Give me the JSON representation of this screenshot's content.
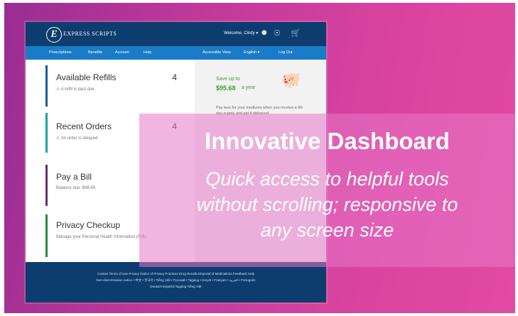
{
  "header": {
    "brand": "EXPRESS SCRIPTS",
    "welcome": "Welcome, Cindy ▾",
    "icons": [
      "user-icon",
      "globe-icon",
      "cart-icon"
    ]
  },
  "nav": {
    "left": [
      "Prescriptions",
      "Benefits",
      "Account",
      "Help"
    ],
    "right": [
      "Accessible View",
      "English ▾",
      "Log Out"
    ]
  },
  "cards": [
    {
      "title": "Available Refills",
      "subtitle": "⚠ A refill is past due",
      "count": "4",
      "accent": "#1a5a9a"
    },
    {
      "title": "Recent Orders",
      "subtitle": "⚠ An order is delayed",
      "count": "4",
      "accent": "#1aa3a3"
    },
    {
      "title": "Pay a Bill",
      "subtitle": "Balance due: $48.45",
      "count": "",
      "accent": "#6a2d6e"
    },
    {
      "title": "Privacy Checkup",
      "subtitle": "Manage your Personal Health Information (PHI)",
      "count": "",
      "accent": "#2a8a3a"
    }
  ],
  "savings": {
    "line1": "Save up to",
    "amount": "$95.68",
    "suffix": "a year",
    "body": "Pay less for your medicine when you receive a 90-day supply and get it delivered.",
    "icon": "piggy-bank-icon"
  },
  "footer": {
    "line1": "Contact   Terms of Use   Privacy   Notice of Privacy Practices   Drug Recalls   Disposal of Medications   Feedback   Help",
    "line2": "Non-discrimination notice • 中文 • 한국어 • Tiếng Việt • Русский • Tagalog • Kreyòl • Français • العربية • Português",
    "line3": "Deutsch   Español   Tagalog   Tiếng Việt"
  },
  "overlay": {
    "title": "Innovative Dashboard",
    "line1": "Quick access to helpful tools",
    "line2": "without scrolling; responsive to",
    "line3": "any screen size"
  },
  "colors": {
    "header": "#0d3d6e",
    "nav": "#1a7cc7",
    "savings_green": "#3aa02a",
    "overlay": "#e878c8"
  }
}
